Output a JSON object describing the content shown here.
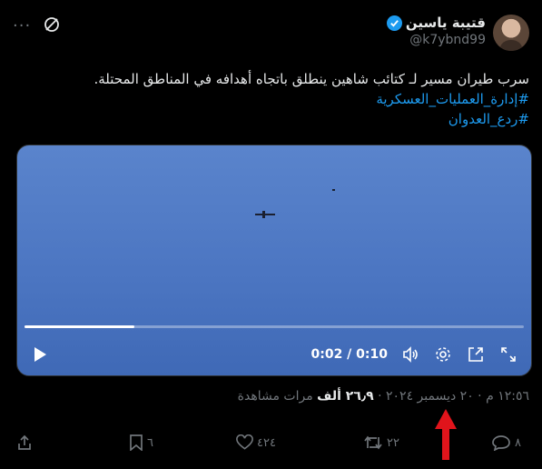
{
  "header": {
    "display_name": "قتيبة ياسين",
    "handle": "@k7ybnd99"
  },
  "tweet": {
    "text": "سرب طيران مسير لـ كتائب شاهين ينطلق باتجاه أهدافه في المناطق المحتلة.",
    "hashtags": [
      "#إدارة_العمليات_العسكرية",
      "#ردع_العدوان"
    ]
  },
  "video": {
    "time_display": "0:02 / 0:10",
    "progress": 0.22
  },
  "meta": {
    "time": "١٢:٥٦ م",
    "date": "٢٠ ديسمبر ٢٠٢٤",
    "views_count": "٢٦٫٩ ألف",
    "views_label": "مرات مشاهدة",
    "separator": "·"
  },
  "actions": {
    "replies": "٨",
    "reposts": "٢٢",
    "likes": "٤٢٤",
    "bookmarks": "٦"
  },
  "colors": {
    "accent": "#1d9bf0",
    "annotation_arrow": "#e0141b"
  }
}
